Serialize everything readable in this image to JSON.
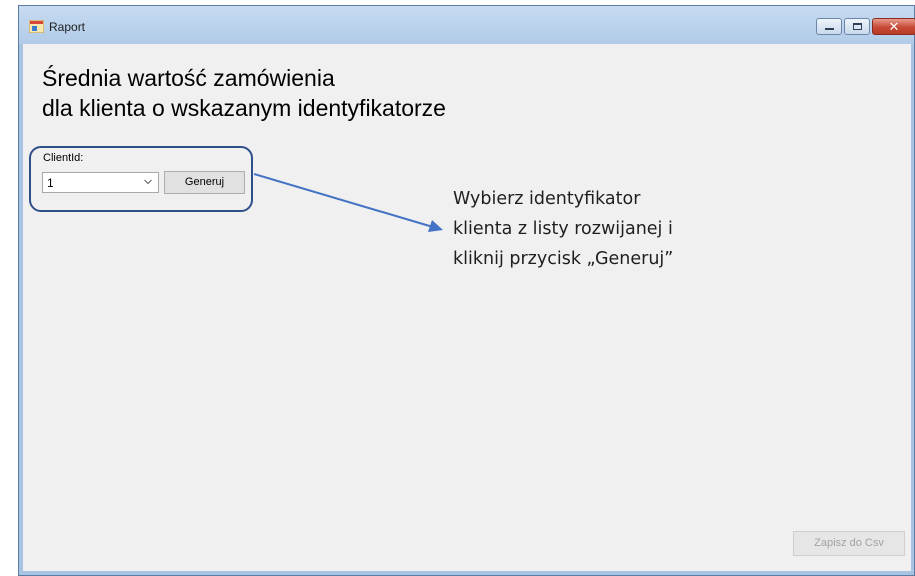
{
  "window": {
    "title": "Raport",
    "controls": {
      "minimize": "minimize-icon",
      "maximize": "maximize-icon",
      "close": "✕"
    }
  },
  "heading": {
    "line1": "Średnia wartość zamówienia",
    "line2": "dla klienta o wskazanym identyfikatorze"
  },
  "form": {
    "client_label": "ClientId:",
    "client_select_value": "1",
    "generate_label": "Generuj"
  },
  "annotation": {
    "lines": [
      "Wybierz identyfikator",
      "klienta z listy rozwijanej i",
      "kliknij przycisk „Generuj”"
    ]
  },
  "footer": {
    "save_csv_label": "Zapisz do Csv"
  },
  "colors": {
    "annotation_outline": "#2f4f8a",
    "arrow": "#4472c4",
    "client_bg": "#f0f0f0",
    "frame": "#a9c4e2"
  }
}
